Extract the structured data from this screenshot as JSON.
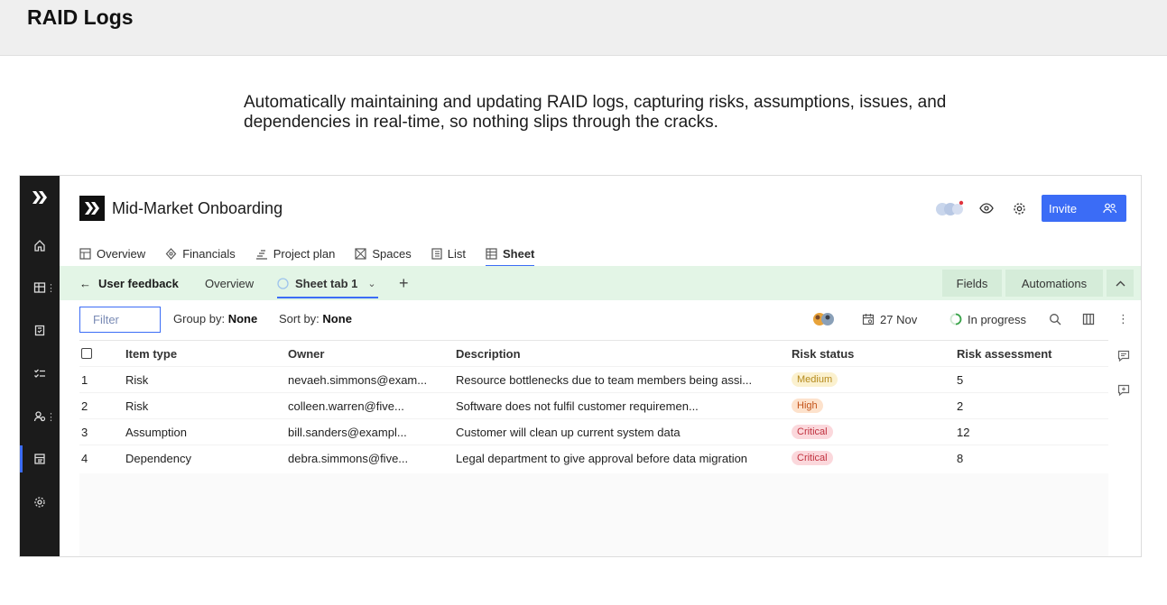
{
  "slide": {
    "title": "RAID Logs",
    "intro": "Automatically maintaining and updating RAID logs, capturing risks, assumptions, issues, and dependencies in real-time, so nothing slips through the cracks."
  },
  "header": {
    "project_title": "Mid-Market Onboarding",
    "invite_label": "Invite"
  },
  "tabs": [
    {
      "label": "Overview"
    },
    {
      "label": "Financials"
    },
    {
      "label": "Project plan"
    },
    {
      "label": "Spaces"
    },
    {
      "label": "List"
    },
    {
      "label": "Sheet"
    }
  ],
  "subbar": {
    "back_label": "User feedback",
    "overview_label": "Overview",
    "sheet_tab_label": "Sheet tab 1",
    "fields_label": "Fields",
    "automations_label": "Automations"
  },
  "toolbar": {
    "filter_placeholder": "Filter",
    "group_by_label": "Group by:",
    "group_by_value": "None",
    "sort_by_label": "Sort by:",
    "sort_by_value": "None",
    "date": "27 Nov",
    "status": "In progress"
  },
  "table": {
    "columns": [
      "Item type",
      "Owner",
      "Description",
      "Risk status",
      "Risk assessment"
    ],
    "rows": [
      {
        "num": "1",
        "type": "Risk",
        "owner": "nevaeh.simmons@exam...",
        "description": "Resource bottlenecks due to team members being assi...",
        "status": "Medium",
        "assessment": "5"
      },
      {
        "num": "2",
        "type": "Risk",
        "owner": "colleen.warren@five...",
        "description": "Software does not fulfil customer requiremen...",
        "status": "High",
        "assessment": "2"
      },
      {
        "num": "3",
        "type": "Assumption",
        "owner": "bill.sanders@exampl...",
        "description": "Customer will clean up current system data",
        "status": "Critical",
        "assessment": "12"
      },
      {
        "num": "4",
        "type": "Dependency",
        "owner": "debra.simmons@five...",
        "description": "Legal department to give approval before data migration",
        "status": "Critical",
        "assessment": "8"
      }
    ]
  },
  "colors": {
    "accent": "#3b6cf6",
    "rail": "#1b1b1b",
    "subbar": "#e3f5e6"
  }
}
